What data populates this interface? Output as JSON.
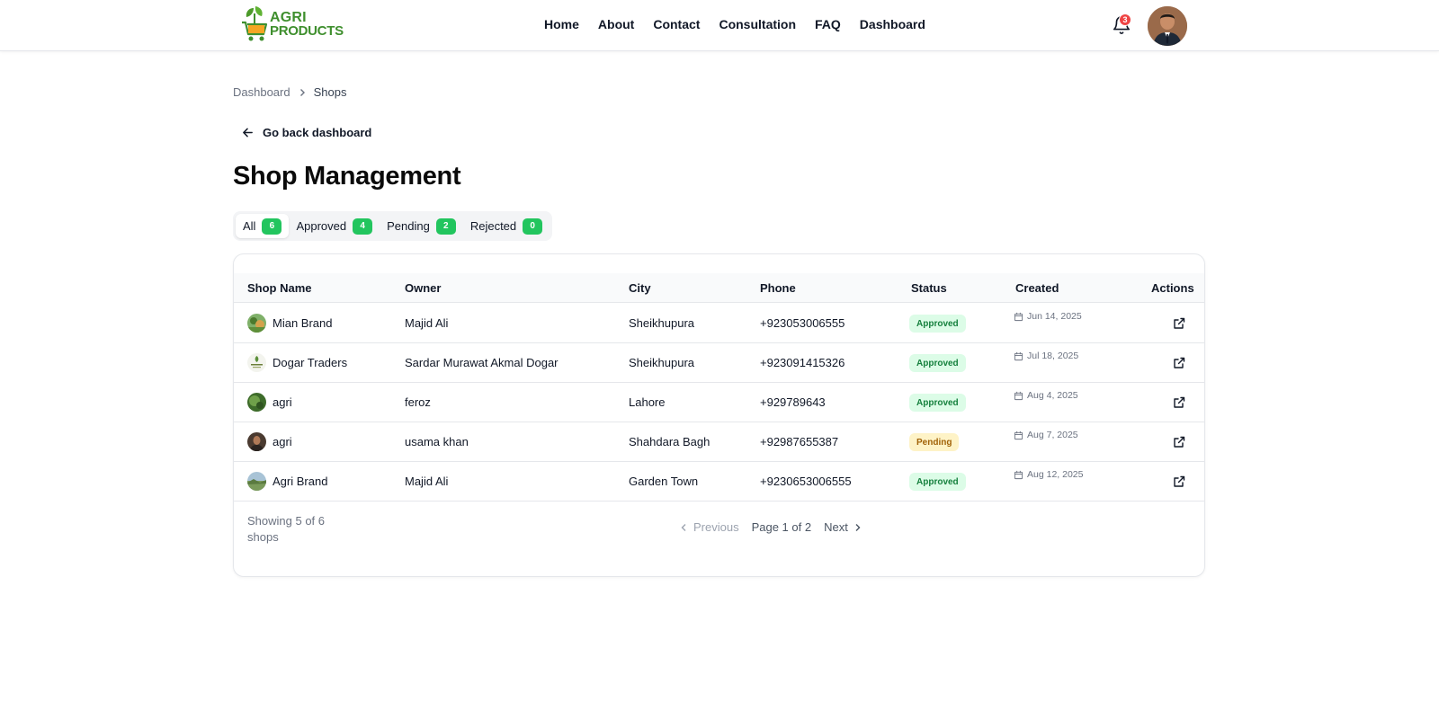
{
  "brand": {
    "line1": "AGRI",
    "line2": "PRODUCTS",
    "color": "#3f8f2e"
  },
  "nav": {
    "items": [
      "Home",
      "About",
      "Contact",
      "Consultation",
      "FAQ",
      "Dashboard"
    ]
  },
  "notifications": {
    "count": "3",
    "icon": "bell-icon"
  },
  "breadcrumb": {
    "parent": "Dashboard",
    "current": "Shops"
  },
  "back_button": {
    "label": "Go back dashboard"
  },
  "page_title": "Shop Management",
  "tabs": [
    {
      "label": "All",
      "count": "6"
    },
    {
      "label": "Approved",
      "count": "4"
    },
    {
      "label": "Pending",
      "count": "2"
    },
    {
      "label": "Rejected",
      "count": "0"
    }
  ],
  "table": {
    "headers": [
      "Shop Name",
      "Owner",
      "City",
      "Phone",
      "Status",
      "Created",
      "Actions"
    ],
    "rows": [
      {
        "shop": "Mian Brand",
        "owner": "Majid Ali",
        "city": "Sheikhupura",
        "phone": "+923053006555",
        "status": "Approved",
        "created": "Jun 14, 2025"
      },
      {
        "shop": "Dogar Traders",
        "owner": "Sardar Murawat Akmal Dogar",
        "city": "Sheikhupura",
        "phone": "+923091415326",
        "status": "Approved",
        "created": "Jul 18, 2025"
      },
      {
        "shop": "agri",
        "owner": "feroz",
        "city": "Lahore",
        "phone": "+929789643",
        "status": "Approved",
        "created": "Aug 4, 2025"
      },
      {
        "shop": "agri",
        "owner": "usama khan",
        "city": "Shahdara Bagh",
        "phone": "+92987655387",
        "status": "Pending",
        "created": "Aug 7, 2025"
      },
      {
        "shop": "Agri Brand",
        "owner": "Majid Ali",
        "city": "Garden Town",
        "phone": "+9230653006555",
        "status": "Approved",
        "created": "Aug 12, 2025"
      }
    ]
  },
  "pagination": {
    "showing": "Showing 5 of 6 shops",
    "previous": "Previous",
    "page_label": "Page 1 of 2",
    "next": "Next"
  },
  "colors": {
    "accent_green": "#22c55e",
    "approved_bg": "#dcfce7",
    "approved_fg": "#15803d",
    "pending_bg": "#fef3c7",
    "pending_fg": "#a16207",
    "badge_red": "#ef4444"
  }
}
